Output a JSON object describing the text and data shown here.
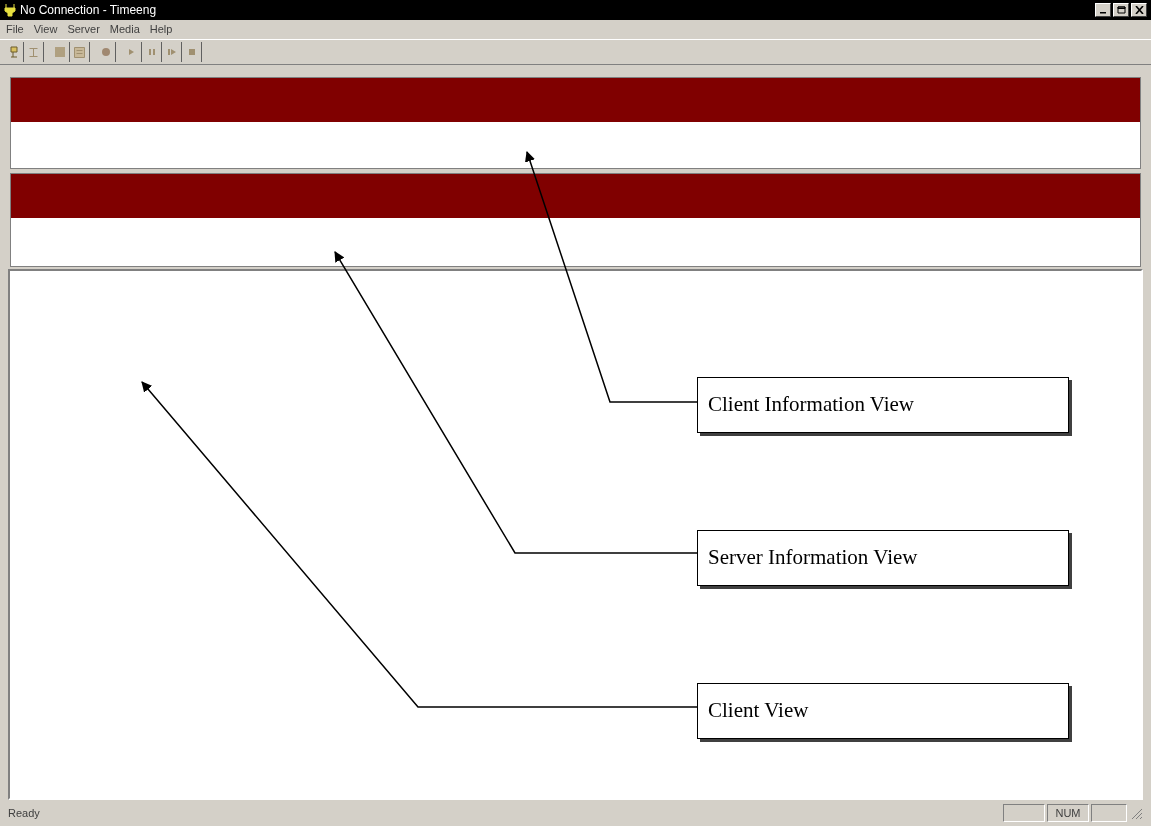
{
  "window": {
    "title": "No Connection - Timeeng"
  },
  "menu": [
    "File",
    "View",
    "Server",
    "Media",
    "Help"
  ],
  "callouts": [
    {
      "label": "Client Information View"
    },
    {
      "label": "Server Information View"
    },
    {
      "label": "Client View"
    }
  ],
  "status_bar": {
    "message": "Ready",
    "indicator": "NUM"
  }
}
